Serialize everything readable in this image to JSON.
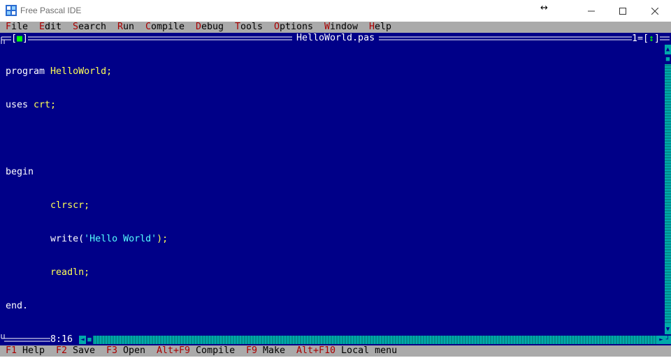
{
  "window": {
    "title": "Free Pascal IDE"
  },
  "menu": [
    {
      "hotkey": "F",
      "rest": "ile"
    },
    {
      "hotkey": "E",
      "rest": "dit"
    },
    {
      "hotkey": "S",
      "rest": "earch"
    },
    {
      "hotkey": "R",
      "rest": "un"
    },
    {
      "hotkey": "C",
      "rest": "ompile"
    },
    {
      "hotkey": "D",
      "rest": "ebug"
    },
    {
      "hotkey": "T",
      "rest": "ools"
    },
    {
      "hotkey": "O",
      "rest": "ptions"
    },
    {
      "hotkey": "W",
      "rest": "indow"
    },
    {
      "hotkey": "H",
      "rest": "elp"
    }
  ],
  "editor": {
    "filename": "HelloWorld.pas",
    "window_number": "1",
    "cursor_position": "8:16",
    "code": {
      "l1_kw": "program ",
      "l1_id": "HelloWorld;",
      "l2_kw": "uses ",
      "l2_id": "crt;",
      "l4": "begin",
      "l5_indent": "        ",
      "l5_id": "clrscr;",
      "l6_kw": "write(",
      "l6_str": "'Hello World'",
      "l6_end": ");",
      "l7_id": "readln;",
      "l8": "end."
    }
  },
  "status": [
    {
      "key": "F1",
      "label": " Help"
    },
    {
      "key": "F2",
      "label": " Save"
    },
    {
      "key": "F3",
      "label": " Open"
    },
    {
      "key": "Alt+F9",
      "label": " Compile"
    },
    {
      "key": "F9",
      "label": " Make"
    },
    {
      "key": "Alt+F10",
      "label": " Local menu"
    }
  ],
  "colors": {
    "desktop_blue": "#000088",
    "menu_gray": "#aaaaaa",
    "hotkey_red": "#aa0000",
    "identifier_yellow": "#ffff55",
    "string_cyan": "#55ffff",
    "scroll_teal": "#00aaaa"
  }
}
